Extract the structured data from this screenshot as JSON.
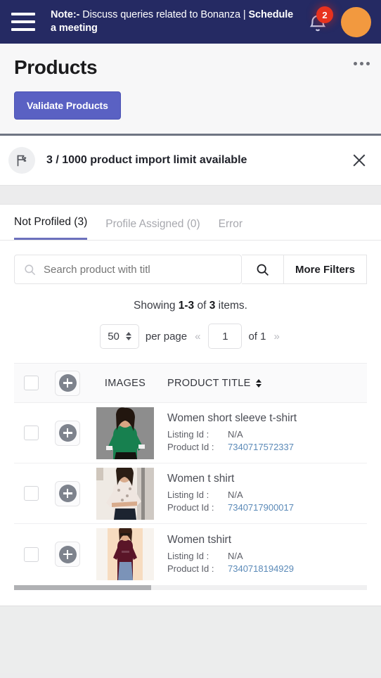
{
  "topbar": {
    "menu_icon": "hamburger-icon",
    "note_prefix": "Note:-",
    "note_body": " Discuss queries related to Bonanza | ",
    "note_link": "Schedule a meeting",
    "notification_icon": "bell-icon",
    "notification_count": "2",
    "avatar_icon": "user-avatar",
    "bg_color": "#252a63",
    "badge_color": "#e8321e",
    "avatar_color": "#f2993f"
  },
  "page": {
    "title": "Products",
    "kebab_icon": "more-options-icon",
    "validate_button": "Validate Products",
    "accent_color": "#5a61c3"
  },
  "banner": {
    "icon": "flag-icon",
    "text": "3 / 1000 product import limit available",
    "close_icon": "close-icon"
  },
  "tabs": [
    {
      "label": "Not Profiled (3)",
      "active": true
    },
    {
      "label": "Profile Assigned (0)",
      "active": false
    },
    {
      "label": "Error",
      "active": false
    }
  ],
  "search": {
    "placeholder": "Search product with titl",
    "value": "",
    "search_icon": "search-icon",
    "submit_icon": "search-icon",
    "more_filters_label": "More Filters"
  },
  "pagination": {
    "showing_prefix": "Showing ",
    "showing_range": "1-3",
    "showing_middle": " of ",
    "showing_total": "3",
    "showing_suffix": " items.",
    "per_page_value": "50",
    "per_page_label": "per page",
    "prev_icon": "«",
    "next_icon": "»",
    "current_page": "1",
    "of_pages": "of 1"
  },
  "table": {
    "headers": {
      "images": "IMAGES",
      "product_title": "PRODUCT TITLE",
      "sort_icon": "sort-icon",
      "select_all_icon": "checkbox",
      "expand_icon": "plus-icon"
    },
    "rows": [
      {
        "title": "Women short sleeve t-shirt",
        "listing_label": "Listing Id :",
        "listing_value": "N/A",
        "product_label": "Product Id :",
        "product_value": "7340717572337",
        "image_alt": "woman-green-top"
      },
      {
        "title": "Women t shirt",
        "listing_label": "Listing Id :",
        "listing_value": "N/A",
        "product_label": "Product Id :",
        "product_value": "7340717900017",
        "image_alt": "woman-floral-top"
      },
      {
        "title": "Women tshirt",
        "listing_label": "Listing Id :",
        "listing_value": "N/A",
        "product_label": "Product Id :",
        "product_value": "7340718194929",
        "image_alt": "woman-maroon-top"
      }
    ]
  }
}
